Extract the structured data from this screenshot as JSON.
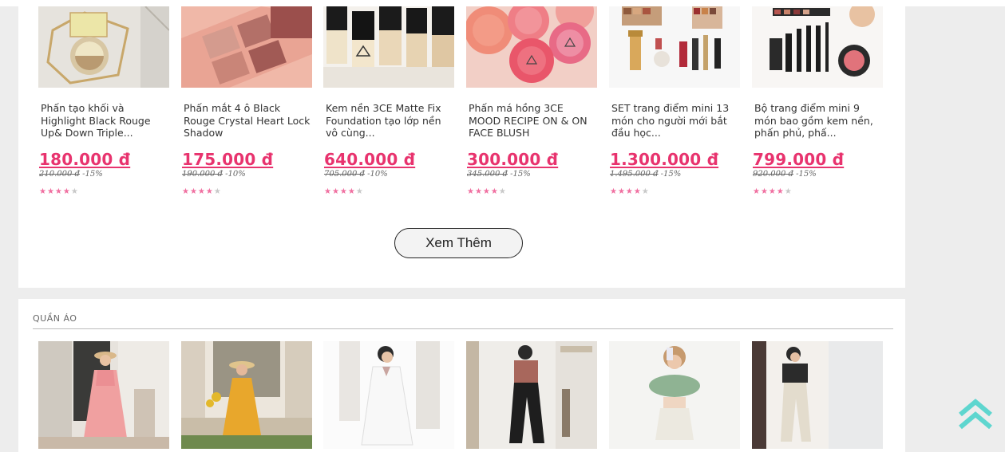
{
  "products": [
    {
      "name": "Phấn tạo khối và Highlight Black Rouge Up& Down Triple...",
      "price": "180.000 đ",
      "old_price": "210.000 đ",
      "discount": "-15%",
      "rating": 4,
      "rating_max": 5
    },
    {
      "name": "Phấn mắt 4 ô Black Rouge Crystal Heart Lock Shadow",
      "price": "175.000 đ",
      "old_price": "190.000 đ",
      "discount": "-10%",
      "rating": 4,
      "rating_max": 5
    },
    {
      "name": "Kem nền 3CE Matte Fix Foundation tạo lớp nền vô cùng...",
      "price": "640.000 đ",
      "old_price": "705.000 đ",
      "discount": "-10%",
      "rating": 4,
      "rating_max": 5
    },
    {
      "name": "Phấn má hồng 3CE MOOD RECIPE ON & ON FACE BLUSH",
      "price": "300.000 đ",
      "old_price": "345.000 đ",
      "discount": "-15%",
      "rating": 4,
      "rating_max": 5
    },
    {
      "name": "SET trang điểm mini 13 món cho người mới bắt đầu học...",
      "price": "1.300.000 đ",
      "old_price": "1.495.000 đ",
      "discount": "-15%",
      "rating": 4,
      "rating_max": 5
    },
    {
      "name": "Bộ trang điểm mini 9 món bao gồm kem nền, phấn phủ, phấ...",
      "price": "799.000 đ",
      "old_price": "920.000 đ",
      "discount": "-15%",
      "rating": 4,
      "rating_max": 5
    }
  ],
  "more_button": "Xem Thêm",
  "clothes_section": {
    "title": "QUẦN ÁO",
    "items": [
      {
        "alt": "pink floral dress"
      },
      {
        "alt": "yellow sunflower dress"
      },
      {
        "alt": "white dress"
      },
      {
        "alt": "black pants outfit"
      },
      {
        "alt": "green crop top outfit"
      },
      {
        "alt": "black shirt and beige pants"
      }
    ]
  },
  "icons": {
    "scroll_top": "double-chevron-up-icon"
  },
  "colors": {
    "price": "#e8336e",
    "star_on": "#f06fa0",
    "star_off": "#c8c8c8",
    "scroll_top": "#5ed6cf"
  }
}
